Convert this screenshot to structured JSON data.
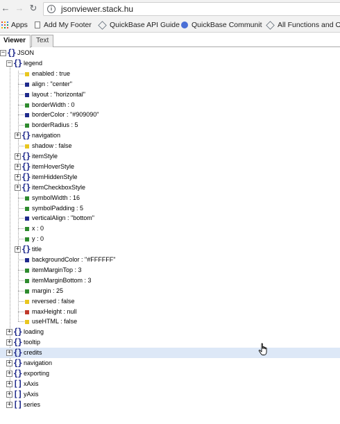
{
  "browser": {
    "back_icon": "arrow-left-icon",
    "forward_icon": "arrow-right-icon",
    "info_icon": "info-icon",
    "url": "jsonviewer.stack.hu",
    "bookmarks": [
      {
        "label": "Apps",
        "icon": "apps-grid-icon"
      },
      {
        "label": "Add My Footer",
        "icon": "document-icon"
      },
      {
        "label": "QuickBase API Guide",
        "icon": "quickbase-icon"
      },
      {
        "label": "QuickBase Communit",
        "icon": "circle-icon"
      },
      {
        "label": "All Functions and Op",
        "icon": "quickbase-icon"
      }
    ]
  },
  "tabs": {
    "viewer": "Viewer",
    "text": "Text"
  },
  "tree": {
    "root": "JSON",
    "legend": "legend",
    "legend_children": [
      {
        "text": "enabled : true",
        "color": "#e8c61f"
      },
      {
        "text": "align : \"center\"",
        "color": "#1f2a8c"
      },
      {
        "text": "layout : \"horizontal\"",
        "color": "#1f2a8c"
      },
      {
        "text": "borderWidth : 0",
        "color": "#2e8b2e"
      },
      {
        "text": "borderColor : \"#909090\"",
        "color": "#1f2a8c"
      },
      {
        "text": "borderRadius : 5",
        "color": "#2e8b2e"
      },
      {
        "text": "navigation",
        "color": ""
      },
      {
        "text": "shadow : false",
        "color": "#e8c61f"
      },
      {
        "text": "itemStyle",
        "color": ""
      },
      {
        "text": "itemHoverStyle",
        "color": ""
      },
      {
        "text": "itemHiddenStyle",
        "color": ""
      },
      {
        "text": "itemCheckboxStyle",
        "color": ""
      },
      {
        "text": "symbolWidth : 16",
        "color": "#2e8b2e"
      },
      {
        "text": "symbolPadding : 5",
        "color": "#2e8b2e"
      },
      {
        "text": "verticalAlign : \"bottom\"",
        "color": "#1f2a8c"
      },
      {
        "text": "x : 0",
        "color": "#2e8b2e"
      },
      {
        "text": "y : 0",
        "color": "#2e8b2e"
      },
      {
        "text": "title",
        "color": ""
      },
      {
        "text": "backgroundColor : \"#FFFFFF\"",
        "color": "#1f2a8c"
      },
      {
        "text": "itemMarginTop : 3",
        "color": "#2e8b2e"
      },
      {
        "text": "itemMarginBottom : 3",
        "color": "#2e8b2e"
      },
      {
        "text": "margin : 25",
        "color": "#2e8b2e"
      },
      {
        "text": "reversed : false",
        "color": "#e8c61f"
      },
      {
        "text": "maxHeight : null",
        "color": "#c0392b"
      },
      {
        "text": "useHTML : false",
        "color": "#e8c61f"
      }
    ],
    "top_level": [
      {
        "text": "loading",
        "type": "object"
      },
      {
        "text": "tooltip",
        "type": "object"
      },
      {
        "text": "credits",
        "type": "object"
      },
      {
        "text": "navigation",
        "type": "object"
      },
      {
        "text": "exporting",
        "type": "object"
      },
      {
        "text": "xAxis",
        "type": "array"
      },
      {
        "text": "yAxis",
        "type": "array"
      },
      {
        "text": "series",
        "type": "array"
      }
    ]
  }
}
